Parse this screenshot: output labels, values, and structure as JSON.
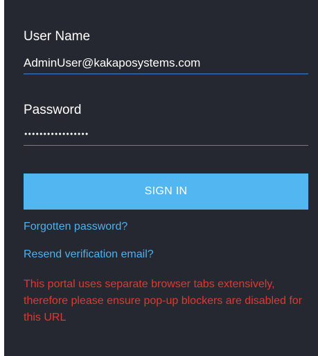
{
  "login": {
    "username_label": "User Name",
    "username_value": "AdminUser@kakaposystems.com",
    "password_label": "Password",
    "password_value": "•••••••••••••••••",
    "signin_label": "SIGN IN",
    "forgot_password_link": "Forgotten password?",
    "resend_verification_link": "Resend verification email?",
    "popup_notice": "This portal uses separate browser tabs extensively, therefore please ensure pop-up blockers are disabled for this URL"
  },
  "colors": {
    "panel_background": "#252830",
    "button_background": "#52b6f0",
    "link_color": "#4db1f0",
    "input_underline": "#3f86d6",
    "notice_color": "#e0392f"
  }
}
